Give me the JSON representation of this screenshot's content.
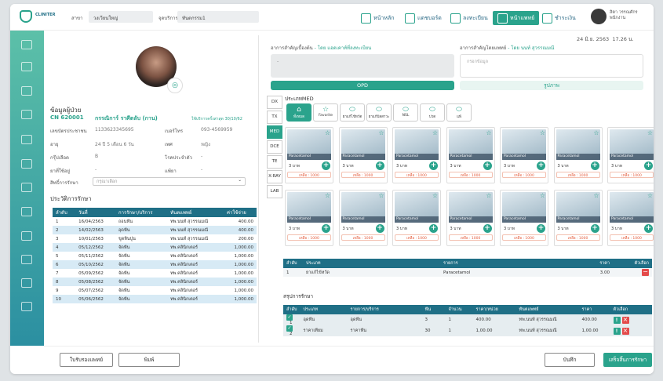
{
  "header": {
    "logo_text": "CLINITER",
    "branch_label": "สาขา",
    "branch_value": "วงเวียนใหญ่",
    "service_label": "จุดบริการ",
    "service_value": "ทันตกรรม1",
    "nav": [
      {
        "label": "หน้าหลัก",
        "icon": "home-icon"
      },
      {
        "label": "แดชบอร์ด",
        "icon": "dashboard-icon"
      },
      {
        "label": "ลงทะเบียน",
        "icon": "register-icon"
      },
      {
        "label": "หน้าแพทย์",
        "icon": "stethoscope-icon",
        "active": true
      },
      {
        "label": "ชำระเงิน",
        "icon": "payment-icon"
      }
    ],
    "user_name": "สิตา วรรณศักร",
    "user_role": "พนักงาน"
  },
  "patient": {
    "section_title": "ข้อมูลผู้ป่วย",
    "cn": "CN 620001",
    "name": "กรรณิการ์ ราศีตลับ (กาน)",
    "last_visit": "ใช้บริการครั้งล่าสุด 30/10/62",
    "fields": [
      {
        "label": "เลขบัตรประชาชน",
        "value": "1133623345695"
      },
      {
        "label": "อายุ",
        "value": "24 ปี 5 เดือน 6 วัน"
      },
      {
        "label": "กรุ๊ปเลือด",
        "value": "B"
      },
      {
        "label": "ยาที่ใช้อยู่",
        "value": "-"
      },
      {
        "label": "เบอร์โทร",
        "value": "093-4569959"
      },
      {
        "label": "เพศ",
        "value": "หญิง"
      },
      {
        "label": "โรคประจำตัว",
        "value": "-"
      },
      {
        "label": "แพ้ยา",
        "value": "-"
      }
    ],
    "rights_label": "สิทธิ์การรักษา",
    "rights_placeholder": "กรุณาเลือก"
  },
  "history": {
    "title": "ประวัติการรักษา",
    "headers": [
      "ลำดับ",
      "วันที่",
      "การรักษา/บริการ",
      "ทันตแพทย์",
      "ค่าใช้จ่าย"
    ],
    "rows": [
      [
        "1",
        "16/04/2563",
        "ถอนฟัน",
        "ทพ.นนท์ สุวรรณมณี",
        "400.00"
      ],
      [
        "2",
        "14/02/2563",
        "อุดฟัน",
        "ทพ.นนท์ สุวรรณมณี",
        "400.00"
      ],
      [
        "3",
        "10/01/2563",
        "ขูดหินปูน",
        "ทพ.นนท์ สุวรรณมณี",
        "200.00"
      ],
      [
        "4",
        "05/12/2562",
        "จัดฟัน",
        "ทพ.คลินิกเตอร์",
        "1,000.00"
      ],
      [
        "5",
        "05/11/2562",
        "จัดฟัน",
        "ทพ.คลินิกเตอร์",
        "1,000.00"
      ],
      [
        "6",
        "05/10/2562",
        "จัดฟัน",
        "ทพ.คลินิกเตอร์",
        "1,000.00"
      ],
      [
        "7",
        "05/09/2562",
        "จัดฟัน",
        "ทพ.คลินิกเตอร์",
        "1,000.00"
      ],
      [
        "8",
        "05/08/2562",
        "จัดฟัน",
        "ทพ.คลินิกเตอร์",
        "1,000.00"
      ],
      [
        "9",
        "05/07/2562",
        "จัดฟัน",
        "ทพ.คลินิกเตอร์",
        "1,000.00"
      ],
      [
        "10",
        "05/06/2562",
        "จัดฟัน",
        "ทพ.คลินิกเตอร์",
        "1,000.00"
      ]
    ]
  },
  "symptoms": {
    "date": "24 มิ.ย. 2563",
    "time": "17.26 น.",
    "initial_label": "อาการสำคัญเบื้องต้น",
    "initial_by": "- โดย แอดเคาท์ที่ลงทะเบียน",
    "doctor_label": "อาการสำคัญโดยแพทย์",
    "doctor_by": "- โดย นนท์ สุวรรณมณี",
    "doctor_placeholder": "กรอกข้อมูล",
    "initial_value": "-",
    "tab_opd": "OPD",
    "tab_image": "รูปภาพ"
  },
  "med": {
    "title": "ประเภทMED",
    "left_tabs": [
      "DX",
      "TX",
      "MED",
      "DCE",
      "TE",
      "X-RAY",
      "LAB"
    ],
    "active_tab": "MED",
    "categories": [
      {
        "label": "ทั้งหมด",
        "icon": "all-icon",
        "active": true
      },
      {
        "label": "Favorite",
        "icon": "star-icon"
      },
      {
        "label": "ยาแก้ไข้หวัด",
        "icon": "pill-icon"
      },
      {
        "label": "ยาแก้ปัสสาวะ",
        "icon": "pill-icon"
      },
      {
        "label": "NSL",
        "icon": "pill-icon"
      },
      {
        "label": "ปวด",
        "icon": "pill-icon"
      },
      {
        "label": "แพ้",
        "icon": "pill-icon"
      }
    ],
    "card_name": "Paracetamol",
    "card_price": "3 บาท",
    "card_stock": "เหลือ : 1000"
  },
  "med_table": {
    "headers": [
      "ลำดับ",
      "ประเภท",
      "รายการ",
      "ราคา",
      "ตัวเลือก"
    ],
    "rows": [
      [
        "1",
        "ยาแก้ไข้หวัด",
        "Paracetamol",
        "3.00"
      ]
    ]
  },
  "summary": {
    "title": "สรุปการรักษา",
    "headers": [
      "ลำดับ",
      "ประเภท",
      "รายการ/บริการ",
      "ฟัน",
      "จำนวน",
      "ราคา/หน่วย",
      "ทันตแพทย์",
      "ราคา",
      "ตัวเลือก"
    ],
    "rows": [
      [
        "1",
        "อุดฟัน",
        "อุดฟัน",
        "3",
        "1",
        "400.00",
        "ทพ.นนท์ สุวรรณมณี",
        "400.00"
      ],
      [
        "2",
        "ราคาเทียม",
        "ราคาฟัน",
        "30",
        "1",
        "1,00.00",
        "ทพ.นนท์ สุวรรณมณี",
        "1,00.00"
      ]
    ]
  },
  "footer": {
    "referral": "ใบรับรองแพทย์",
    "print": "พิมพ์",
    "save": "บันทึก",
    "finish": "เสร็จสิ้นการรักษา"
  },
  "colors": {
    "accent": "#2aa38c",
    "navy": "#1f6f86",
    "row_alt": "#d7eaf5"
  }
}
